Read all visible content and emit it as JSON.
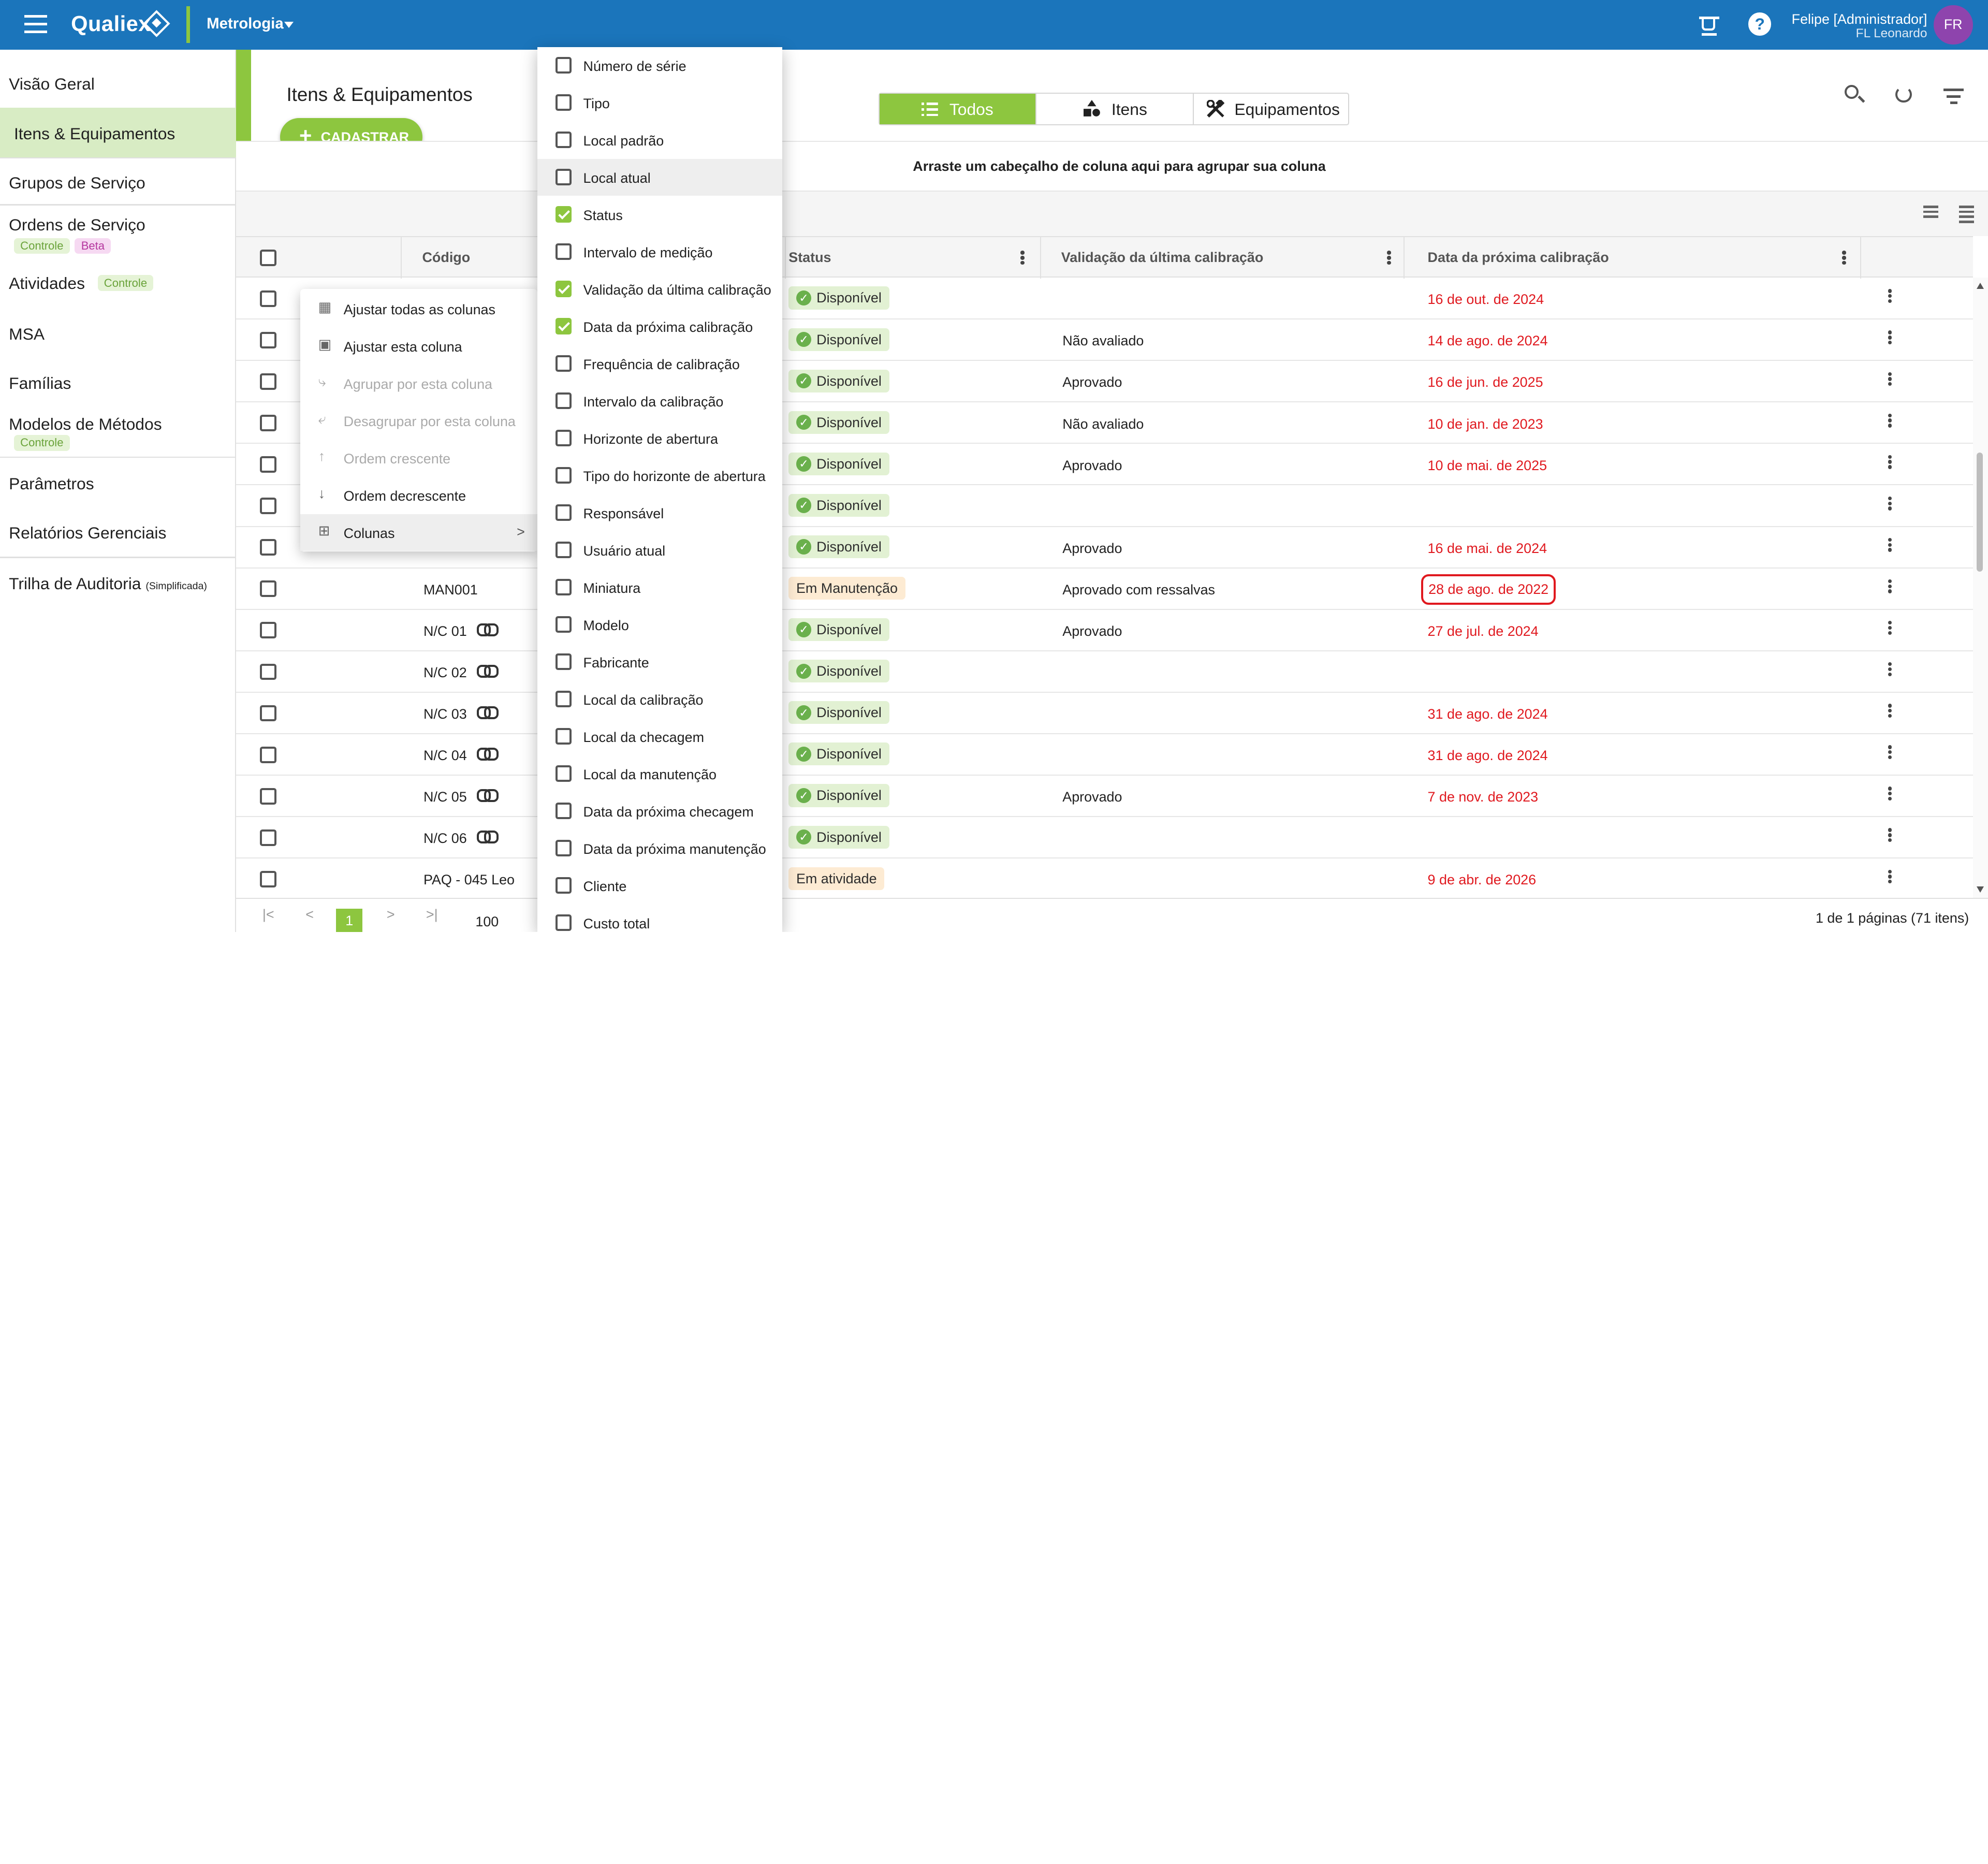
{
  "topbar": {
    "brand": "Qualiex",
    "module": "Metrologia",
    "user_name": "Felipe [Administrador]",
    "user_sub": "FL Leonardo",
    "avatar": "FR",
    "help_label": "?",
    "icons": [
      "menu-icon",
      "coffee-cup-icon",
      "help-icon",
      "chevron-down-icon"
    ]
  },
  "sidebar": {
    "items": [
      {
        "label": "Visão Geral"
      },
      {
        "label": "Itens & Equipamentos",
        "active": true
      },
      {
        "label": "Grupos de Serviço"
      },
      {
        "label": "Ordens de Serviço",
        "tags": [
          "Controle",
          "Beta"
        ]
      },
      {
        "label": "Atividades",
        "tags": [
          "Controle"
        ]
      },
      {
        "label": "MSA"
      },
      {
        "label": "Famílias"
      },
      {
        "label": "Modelos de Métodos",
        "tags": [
          "Controle"
        ]
      },
      {
        "label": "Parâmetros"
      },
      {
        "label": "Relatórios Gerenciais"
      },
      {
        "label": "Trilha de Auditoria",
        "suffix": "(Simplificada)"
      }
    ]
  },
  "main": {
    "title": "Itens & Equipamentos",
    "add_button": "CADASTRAR",
    "tabs": [
      {
        "label": "Todos",
        "active": true
      },
      {
        "label": "Itens"
      },
      {
        "label": "Equipamentos"
      }
    ],
    "grouping_hint": "Arraste um cabeçalho de coluna aqui para agrupar sua coluna"
  },
  "grid": {
    "columns": [
      "Código",
      "Status",
      "Validação da última calibração",
      "Data da próxima calibração"
    ],
    "rows": [
      {
        "code": "",
        "status": "Disponível",
        "status_type": "ok",
        "validation": "",
        "next_cal": "16 de out. de 2024"
      },
      {
        "code": "",
        "status": "Disponível",
        "status_type": "ok",
        "validation": "Não avaliado",
        "next_cal": "14 de ago. de 2024"
      },
      {
        "code": "",
        "status": "Disponível",
        "status_type": "ok",
        "validation": "Aprovado",
        "next_cal": "16 de jun. de 2025"
      },
      {
        "code": "",
        "status": "Disponível",
        "status_type": "ok",
        "validation": "Não avaliado",
        "next_cal": "10 de jan. de 2023"
      },
      {
        "code": "",
        "status": "Disponível",
        "status_type": "ok",
        "validation": "Aprovado",
        "next_cal": "10 de mai. de 2025"
      },
      {
        "code": "",
        "status": "Disponível",
        "status_type": "ok",
        "validation": "",
        "next_cal": ""
      },
      {
        "code": "",
        "status": "Disponível",
        "status_type": "ok",
        "validation": "Aprovado",
        "next_cal": "16 de mai. de 2024"
      },
      {
        "code": "MAN001",
        "status": "Em Manutenção",
        "status_type": "warn",
        "validation": "Aprovado com ressalvas",
        "next_cal": "28 de ago. de 2022",
        "circled": true
      },
      {
        "code": "N/C 01",
        "link": true,
        "status": "Disponível",
        "status_type": "ok",
        "validation": "Aprovado",
        "next_cal": "27 de jul. de 2024"
      },
      {
        "code": "N/C 02",
        "link": true,
        "status": "Disponível",
        "status_type": "ok",
        "validation": "",
        "next_cal": ""
      },
      {
        "code": "N/C 03",
        "link": true,
        "status": "Disponível",
        "status_type": "ok",
        "validation": "",
        "next_cal": "31 de ago. de 2024"
      },
      {
        "code": "N/C 04",
        "link": true,
        "status": "Disponível",
        "status_type": "ok",
        "validation": "",
        "next_cal": "31 de ago. de 2024"
      },
      {
        "code": "N/C 05",
        "link": true,
        "status": "Disponível",
        "status_type": "ok",
        "validation": "Aprovado",
        "next_cal": "7 de nov. de 2023"
      },
      {
        "code": "N/C 06",
        "link": true,
        "status": "Disponível",
        "status_type": "ok",
        "validation": "",
        "next_cal": ""
      },
      {
        "code": "PAQ - 045 Leo",
        "status": "Em atividade",
        "status_type": "warn",
        "validation": "",
        "next_cal": "9 de abr. de 2026"
      }
    ]
  },
  "pager": {
    "current_page": "1",
    "page_size": "100",
    "summary": "1 de 1 páginas (71 itens)"
  },
  "context_menu": {
    "items": [
      {
        "label": "Ajustar todas as colunas",
        "icon": "fit-columns-icon",
        "disabled": false
      },
      {
        "label": "Ajustar esta coluna",
        "icon": "fit-column-icon",
        "disabled": false
      },
      {
        "label": "Agrupar por esta coluna",
        "icon": "group-icon",
        "disabled": true
      },
      {
        "label": "Desagrupar por esta coluna",
        "icon": "ungroup-icon",
        "disabled": true
      },
      {
        "label": "Ordem crescente",
        "icon": "arrow-up-icon",
        "disabled": true
      },
      {
        "label": "Ordem decrescente",
        "icon": "arrow-down-icon",
        "disabled": false
      },
      {
        "label": "Colunas",
        "icon": "columns-icon",
        "disabled": false,
        "submenu": true,
        "hover": true
      }
    ]
  },
  "column_chooser": {
    "items": [
      {
        "label": "Número de série",
        "checked": false
      },
      {
        "label": "Tipo",
        "checked": false
      },
      {
        "label": "Local padrão",
        "checked": false
      },
      {
        "label": "Local atual",
        "checked": false,
        "hover": true
      },
      {
        "label": "Status",
        "checked": true
      },
      {
        "label": "Intervalo de medição",
        "checked": false
      },
      {
        "label": "Validação da última calibração",
        "checked": true
      },
      {
        "label": "Data da próxima calibração",
        "checked": true
      },
      {
        "label": "Frequência de calibração",
        "checked": false
      },
      {
        "label": "Intervalo da calibração",
        "checked": false
      },
      {
        "label": "Horizonte de abertura",
        "checked": false
      },
      {
        "label": "Tipo do horizonte de abertura",
        "checked": false
      },
      {
        "label": "Responsável",
        "checked": false
      },
      {
        "label": "Usuário atual",
        "checked": false
      },
      {
        "label": "Miniatura",
        "checked": false
      },
      {
        "label": "Modelo",
        "checked": false
      },
      {
        "label": "Fabricante",
        "checked": false
      },
      {
        "label": "Local da calibração",
        "checked": false
      },
      {
        "label": "Local da checagem",
        "checked": false
      },
      {
        "label": "Local da manutenção",
        "checked": false
      },
      {
        "label": "Data da próxima checagem",
        "checked": false
      },
      {
        "label": "Data da próxima manutenção",
        "checked": false
      },
      {
        "label": "Cliente",
        "checked": false
      },
      {
        "label": "Custo total",
        "checked": false
      }
    ]
  },
  "colors": {
    "topbar": "#1b75bb",
    "accent_green": "#8dc63f",
    "date_red": "#e0191f",
    "avatar_purple": "#8e44ad"
  }
}
